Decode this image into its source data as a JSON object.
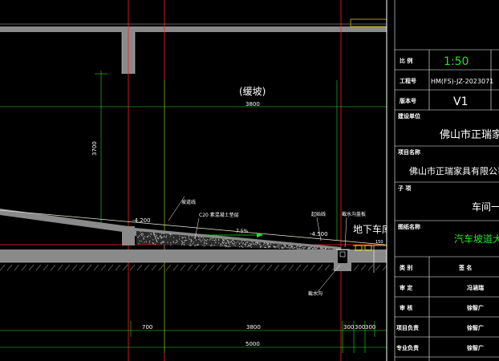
{
  "drawing": {
    "slope_label": "(缓坡)",
    "slope_length_top": "3800",
    "height_dim": "3700",
    "level_left": "-4.200",
    "level_right": "-4.500",
    "concrete_label": "C20 素混凝土垫层",
    "slope_percent": "7.5%",
    "label_slope_line": "坡道线",
    "label_start_line": "起始线",
    "label_interceptor": "截水沟盖板",
    "label_drain": "截水沟",
    "garage_label": "地下车库",
    "small_dim": "150",
    "dims_bottom": [
      "700",
      "3800",
      "300",
      "300",
      "300"
    ],
    "dim_total": "5000"
  },
  "title_block": {
    "rows": [
      {
        "label": "比 例",
        "value": "1:50",
        "color": "#29e029"
      },
      {
        "label": "工程号",
        "value": "HM(FS)-JZ-2023071",
        "color": "#ffffff"
      },
      {
        "label": "版本号",
        "value": "V1",
        "color": "#ffffff"
      }
    ],
    "design_unit_label": "建设单位",
    "design_unit_value": "佛山市正瑞家具",
    "project_label": "项目名称",
    "project_value": "佛山市正瑞家具有限公司家",
    "sub_label": "子 项",
    "sub_value": "车间一",
    "drawing_name_label": "图纸名称",
    "drawing_name_value": "汽车坡道大",
    "signatures": [
      {
        "label": "类 别",
        "value": "签 名"
      },
      {
        "label": "审 定",
        "value": "冯涵瑞"
      },
      {
        "label": "审 核",
        "value": "徐智广"
      },
      {
        "label": "项目负责",
        "value": "徐智广"
      },
      {
        "label": "专业负责",
        "value": "徐智广"
      }
    ]
  }
}
